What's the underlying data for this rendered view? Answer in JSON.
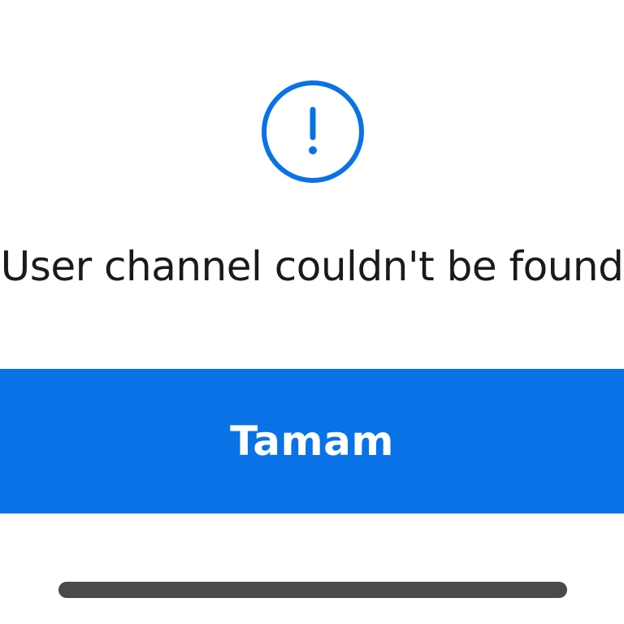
{
  "dialog": {
    "icon": "exclamation-circle-icon",
    "message": "User channel couldn't be found",
    "ok_label": "Tamam"
  },
  "colors": {
    "accent": "#0872e6",
    "text": "#1a1a1a",
    "background": "#ffffff",
    "home_indicator": "#4a4a4a"
  }
}
